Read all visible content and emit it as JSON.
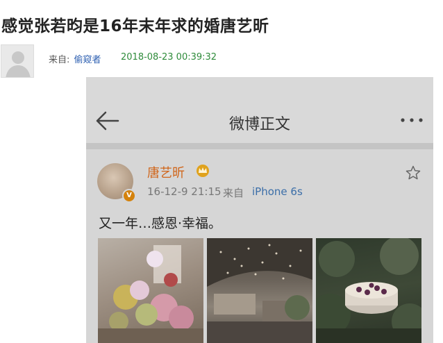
{
  "article": {
    "title": "感觉张若昀是16年末年求的婚唐艺昕",
    "from_label": "来自:",
    "author": "偷窥者",
    "timestamp": "2018-08-23 00:39:32"
  },
  "weibo": {
    "header_title": "微博正文",
    "post": {
      "user_name": "唐艺昕",
      "time": "16-12-9 21:15",
      "from_label": "来自",
      "device": "iPhone 6s",
      "text": "又一年…感恩·幸福。"
    }
  },
  "colors": {
    "title_text": "#222222",
    "author_link": "#2a5db0",
    "timestamp": "#2e8b3a",
    "weibo_username": "#d0651a",
    "weibo_device": "#3b6ea8",
    "verify_badge": "#d4820c"
  },
  "icons": {
    "author_avatar": "default-user-avatar",
    "back": "back-arrow-icon",
    "more": "more-dots-icon",
    "verified": "verified-badge-icon",
    "vip": "vip-crown-icon",
    "favorite": "star-outline-icon"
  }
}
